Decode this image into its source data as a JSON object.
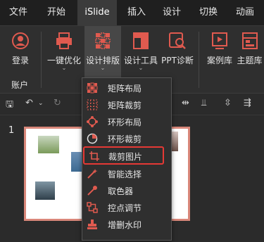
{
  "tabs": [
    "文件",
    "开始",
    "iSlide",
    "插入",
    "设计",
    "切换",
    "动画"
  ],
  "ribbon": {
    "login": "登录",
    "optimize": "一键优化",
    "design_layout": "设计排版",
    "design_tools": "设计工具",
    "ppt_diagnose": "PPT诊断",
    "case_library": "案例库",
    "theme_library": "主题库",
    "account_group": "账户"
  },
  "slide_number": "1",
  "menu": {
    "items": [
      {
        "label": "矩阵布局",
        "icon": "matrix-layout-icon"
      },
      {
        "label": "矩阵裁剪",
        "icon": "matrix-crop-icon"
      },
      {
        "label": "环形布局",
        "icon": "ring-layout-icon"
      },
      {
        "label": "环形裁剪",
        "icon": "ring-crop-icon"
      },
      {
        "label": "裁剪图片",
        "icon": "crop-image-icon"
      },
      {
        "label": "智能选择",
        "icon": "smart-select-icon"
      },
      {
        "label": "取色器",
        "icon": "color-picker-icon"
      },
      {
        "label": "控点调节",
        "icon": "handle-adjust-icon"
      },
      {
        "label": "增删水印",
        "icon": "watermark-icon"
      }
    ],
    "selected_index": 4
  },
  "colors": {
    "accent": "#e05a4f",
    "highlight_border": "#e53935",
    "slide_border": "#d9877a"
  }
}
